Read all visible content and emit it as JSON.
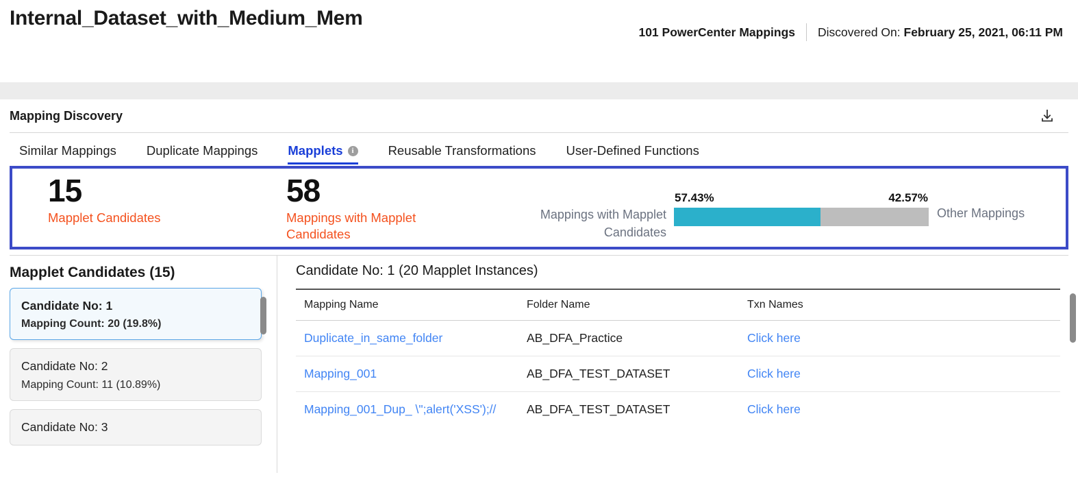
{
  "header": {
    "dataset_title": "Internal_Dataset_with_Medium_Mem",
    "mapping_count": "101 PowerCenter Mappings",
    "discovered_label": "Discovered On:",
    "discovered_value": "February 25, 2021, 06:11 PM"
  },
  "panel": {
    "title": "Mapping Discovery",
    "download_icon": "download-icon"
  },
  "tabs": [
    {
      "label": "Similar Mappings",
      "active": false,
      "info": false
    },
    {
      "label": "Duplicate Mappings",
      "active": false,
      "info": false
    },
    {
      "label": "Mapplets",
      "active": true,
      "info": true
    },
    {
      "label": "Reusable Transformations",
      "active": false,
      "info": false
    },
    {
      "label": "User-Defined Functions",
      "active": false,
      "info": false
    }
  ],
  "stats": {
    "candidates_value": "15",
    "candidates_label": "Mapplet Candidates",
    "mappings_value": "58",
    "mappings_label": "Mappings with Mapplet Candidates",
    "accent_border": "#3c4bc8",
    "label_color": "#f4511e"
  },
  "chart_data": {
    "type": "bar",
    "orientation": "horizontal-stacked",
    "title": "",
    "categories": [
      "Mappings with Mapplet Candidates",
      "Other Mappings"
    ],
    "values": [
      57.43,
      42.57
    ],
    "value_labels": [
      "57.43%",
      "42.57%"
    ],
    "colors": [
      "#2bb0cb",
      "#bdbdbd"
    ],
    "left_label": "Mappings with Mapplet Candidates",
    "right_label": "Other Mappings",
    "xlabel": "",
    "ylabel": "",
    "xlim": [
      0,
      100
    ],
    "grid": false,
    "legend": "inline-labels"
  },
  "left_panel": {
    "title": "Mapplet Candidates (15)",
    "candidates": [
      {
        "name": "Candidate No: 1",
        "count": "Mapping Count: 20 (19.8%)",
        "selected": true
      },
      {
        "name": "Candidate No: 2",
        "count": "Mapping Count: 11 (10.89%)",
        "selected": false
      },
      {
        "name": "Candidate No: 3",
        "count": "",
        "selected": false
      }
    ]
  },
  "right_panel": {
    "heading": "Candidate No: 1 (20 Mapplet Instances)",
    "columns": [
      "Mapping Name",
      "Folder Name",
      "Txn Names"
    ],
    "rows": [
      {
        "mapping_name": "Duplicate_in_same_folder",
        "folder_name": "AB_DFA_Practice",
        "txn_names": "Click here"
      },
      {
        "mapping_name": "Mapping_001",
        "folder_name": "AB_DFA_TEST_DATASET",
        "txn_names": "Click here"
      },
      {
        "mapping_name": "Mapping_001_Dup_ \\\";alert('XSS');//",
        "folder_name": "AB_DFA_TEST_DATASET",
        "txn_names": "Click here"
      }
    ]
  }
}
